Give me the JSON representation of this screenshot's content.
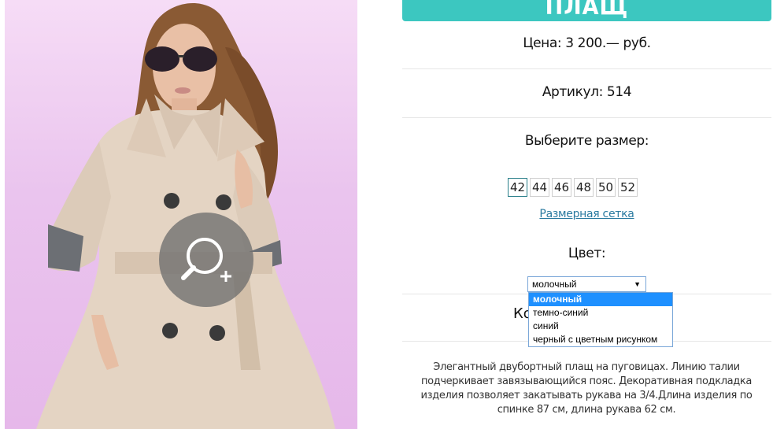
{
  "product": {
    "title": "ПЛАЩ",
    "price": "Цена: 3 200.— руб.",
    "article": "Артикул: 514",
    "choose_size_label": "Выберите размер:",
    "sizes": [
      "42",
      "44",
      "46",
      "48",
      "50",
      "52"
    ],
    "selected_size": "42",
    "size_chart_link": "Размерная сетка",
    "color_label": "Цвет:",
    "color_select": {
      "value": "молочный",
      "options": [
        "молочный",
        "темно-синий",
        "синий",
        "черный с цветным рисунком"
      ]
    },
    "quantity_label_partial": "Ко",
    "description": "Элегантный двубортный плащ на пуговицах. Линию талии подчеркивает завязывающийся пояс. Декоративная подкладка изделия позволяет закатывать рукава на 3/4.Длина изделия по спинке 87 см, длина рукава 62 см."
  },
  "colors": {
    "accent": "#3cc7c0",
    "link": "#2a7aa0",
    "dropdown_highlight": "#1e90ff"
  },
  "icons": {
    "zoom": "zoom-in-icon",
    "select_arrow": "▼"
  }
}
